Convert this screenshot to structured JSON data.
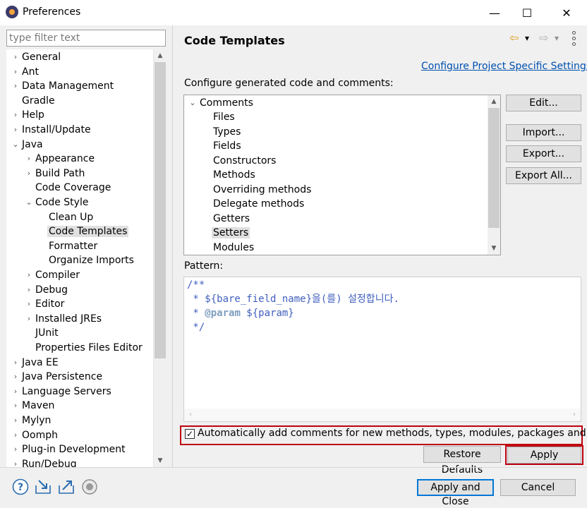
{
  "window": {
    "title": "Preferences",
    "minimize_glyph": "—",
    "maximize_glyph": "☐",
    "close_glyph": "✕"
  },
  "filter": {
    "placeholder": "type filter text",
    "value": ""
  },
  "tree": {
    "items": [
      {
        "label": "General",
        "twisty": "›"
      },
      {
        "label": "Ant",
        "twisty": "›"
      },
      {
        "label": "Data Management",
        "twisty": "›"
      },
      {
        "label": "Gradle",
        "twisty": ""
      },
      {
        "label": "Help",
        "twisty": "›"
      },
      {
        "label": "Install/Update",
        "twisty": "›"
      },
      {
        "label": "Java",
        "twisty": "⌄"
      },
      {
        "label": "Appearance",
        "twisty": "›"
      },
      {
        "label": "Build Path",
        "twisty": "›"
      },
      {
        "label": "Code Coverage",
        "twisty": ""
      },
      {
        "label": "Code Style",
        "twisty": "⌄"
      },
      {
        "label": "Clean Up",
        "twisty": ""
      },
      {
        "label": "Code Templates",
        "twisty": "",
        "selected": true
      },
      {
        "label": "Formatter",
        "twisty": ""
      },
      {
        "label": "Organize Imports",
        "twisty": ""
      },
      {
        "label": "Compiler",
        "twisty": "›"
      },
      {
        "label": "Debug",
        "twisty": "›"
      },
      {
        "label": "Editor",
        "twisty": "›"
      },
      {
        "label": "Installed JREs",
        "twisty": "›"
      },
      {
        "label": "JUnit",
        "twisty": ""
      },
      {
        "label": "Properties Files Editor",
        "twisty": ""
      },
      {
        "label": "Java EE",
        "twisty": "›"
      },
      {
        "label": "Java Persistence",
        "twisty": "›"
      },
      {
        "label": "Language Servers",
        "twisty": "›"
      },
      {
        "label": "Maven",
        "twisty": "›"
      },
      {
        "label": "Mylyn",
        "twisty": "›"
      },
      {
        "label": "Oomph",
        "twisty": "›"
      },
      {
        "label": "Plug-in Development",
        "twisty": "›"
      },
      {
        "label": "Run/Debug",
        "twisty": "›"
      }
    ]
  },
  "page": {
    "title": "Code Templates",
    "configure_link": "Configure Project Specific Settings...",
    "configure_label": "Configure generated code and comments:",
    "pattern_label": "Pattern:",
    "auto_comments_label": "Automatically add comments for new methods, types, modules, packages and files",
    "auto_comments_checked": true
  },
  "templates": {
    "root": {
      "label": "Comments",
      "twisty": "⌄"
    },
    "items": [
      {
        "label": "Files"
      },
      {
        "label": "Types"
      },
      {
        "label": "Fields"
      },
      {
        "label": "Constructors"
      },
      {
        "label": "Methods"
      },
      {
        "label": "Overriding methods"
      },
      {
        "label": "Delegate methods"
      },
      {
        "label": "Getters"
      },
      {
        "label": "Setters",
        "selected": true
      },
      {
        "label": "Modules"
      }
    ]
  },
  "pattern": {
    "line1": "/**",
    "line2": " * ${bare_field_name}을(를) 설정합니다.",
    "line3_prefix": " * ",
    "line3_tag": "@param",
    "line3_rest": " ${param}",
    "line4": " */"
  },
  "buttons": {
    "edit": "Edit...",
    "import": "Import...",
    "export": "Export...",
    "export_all": "Export All...",
    "restore_defaults": "Restore Defaults",
    "apply": "Apply",
    "apply_and_close": "Apply and Close",
    "cancel": "Cancel"
  },
  "icons": {
    "back": "⇦",
    "forward": "⇨",
    "dropdown": "▾",
    "help": "?",
    "import_prefs": "import-icon",
    "export_prefs": "export-icon",
    "oomph": "oomph-icon"
  },
  "colors": {
    "link": "#0050b0",
    "highlight_border": "#c00010",
    "back_arrow": "#e0a020"
  }
}
